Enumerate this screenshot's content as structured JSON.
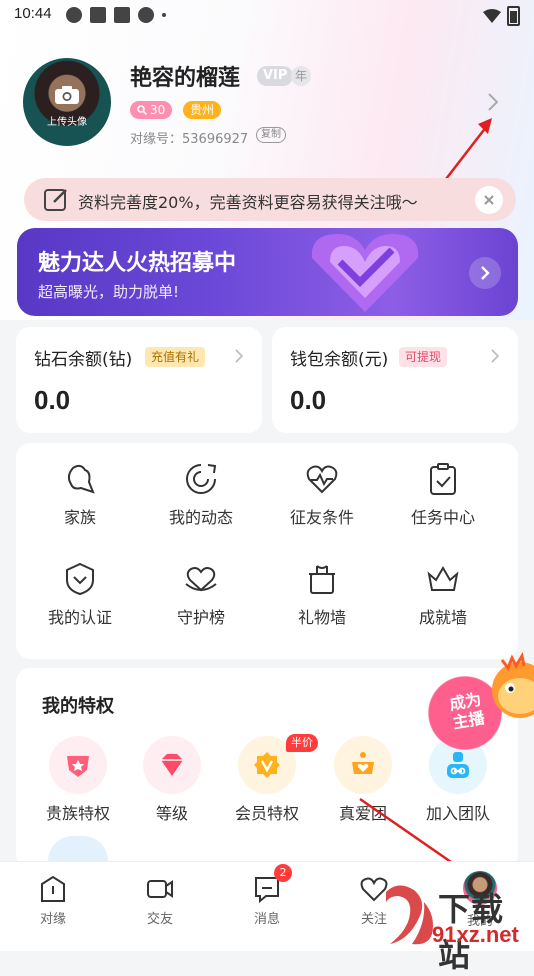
{
  "status_bar": {
    "time": "10:44"
  },
  "profile": {
    "avatar_label": "上传头像",
    "username": "艳容的榴莲",
    "vip": "VIP",
    "vip_suffix": "年",
    "age": "30",
    "location": "贵州",
    "id_label": "对缘号：53696927",
    "copy_label": "复制"
  },
  "notice": {
    "text": "资料完善度20%，完善资料更容易获得关注哦～"
  },
  "banner": {
    "title": "魅力达人火热招募中",
    "subtitle": "超高曝光，助力脱单!"
  },
  "balances": {
    "diamond": {
      "title": "钻石余额(钻)",
      "tag": "充值有礼",
      "value": "0.0"
    },
    "wallet": {
      "title": "钱包余额(元)",
      "tag": "可提现",
      "value": "0.0"
    }
  },
  "menu": [
    {
      "label": "家族",
      "icon": "family-icon"
    },
    {
      "label": "我的动态",
      "icon": "moments-icon"
    },
    {
      "label": "征友条件",
      "icon": "heart-pulse-icon"
    },
    {
      "label": "任务中心",
      "icon": "clipboard-check-icon"
    },
    {
      "label": "我的认证",
      "icon": "shield-check-icon"
    },
    {
      "label": "守护榜",
      "icon": "guard-heart-icon"
    },
    {
      "label": "礼物墙",
      "icon": "gift-icon"
    },
    {
      "label": "成就墙",
      "icon": "crown-icon"
    }
  ],
  "privileges": {
    "title": "我的特权",
    "half_price": "半价",
    "items": [
      {
        "label": "贵族特权",
        "icon": "noble-icon",
        "color": "#ff5f7a"
      },
      {
        "label": "等级",
        "icon": "gem-icon",
        "color": "#ff4a6a"
      },
      {
        "label": "会员特权",
        "icon": "vip-icon",
        "color": "#ffb21e"
      },
      {
        "label": "真爱团",
        "icon": "love-crown-icon",
        "color": "#ffa31a"
      },
      {
        "label": "加入团队",
        "icon": "team-icon",
        "color": "#29b6f6"
      }
    ]
  },
  "success_badge": {
    "line1": "成为",
    "line2": "主播"
  },
  "bottom_nav": {
    "items": [
      {
        "label": "对缘",
        "icon": "home-icon"
      },
      {
        "label": "交友",
        "icon": "video-icon"
      },
      {
        "label": "消息",
        "icon": "message-icon",
        "badge": "2"
      },
      {
        "label": "关注",
        "icon": "heart-icon"
      },
      {
        "label": "我的",
        "icon": "profile-avatar"
      }
    ]
  },
  "watermark": {
    "line1": "下载站",
    "line2": "91xz.net"
  },
  "colors": {
    "accent_pink": "#ff5f8c",
    "banner_purple": "#6c49d8",
    "location_orange": "#ffb21e"
  }
}
